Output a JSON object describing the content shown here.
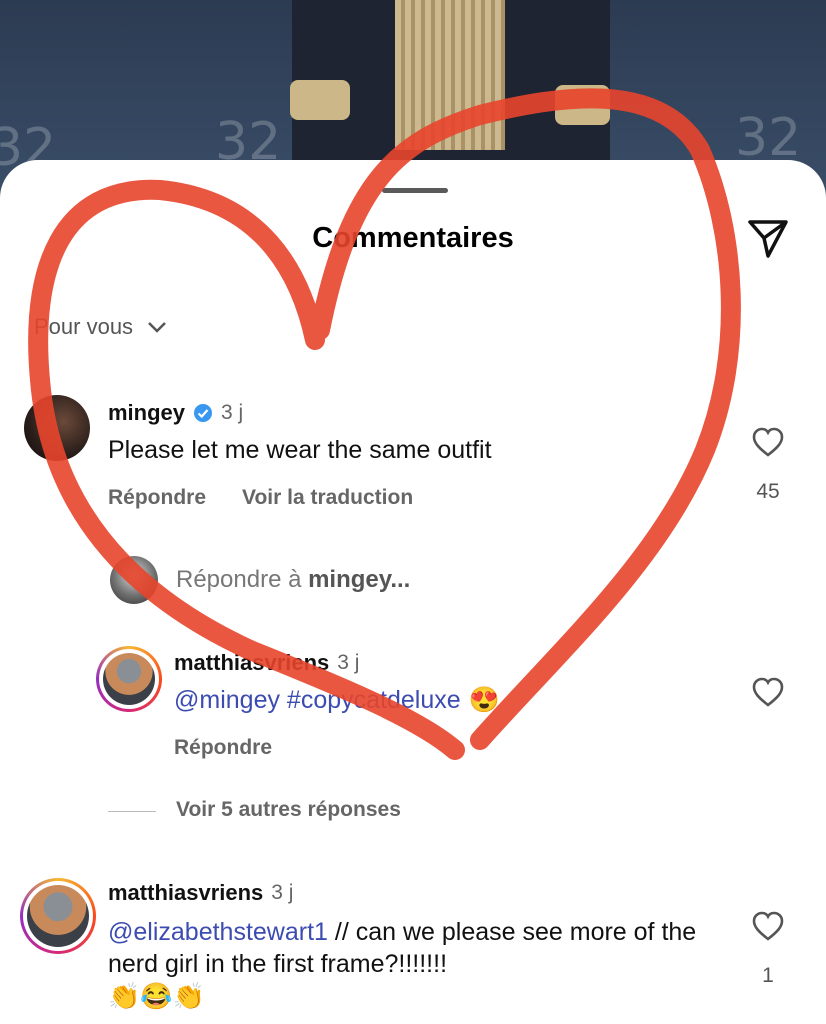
{
  "header": {
    "title": "Commentaires",
    "sort_label": "Pour vous",
    "send_icon": "paper-plane-icon"
  },
  "comments": [
    {
      "username": "mingey",
      "verified": true,
      "time": "3 j",
      "text": "Please let me wear the same outfit",
      "reply_label": "Répondre",
      "translate_label": "Voir la traduction",
      "likes": "45"
    },
    {
      "username": "matthiasvriens",
      "time": "3 j",
      "mention": "@elizabethstewart1",
      "text": " // can we please see more of the nerd girl in the first frame?!!!!!!!",
      "emojis": "👏😂👏",
      "likes": "1"
    }
  ],
  "reply_input": {
    "placeholder_prefix": "Répondre à ",
    "placeholder_user": "mingey..."
  },
  "reply": {
    "username": "matthiasvriens",
    "time": "3 j",
    "text": "@mingey #copycatdeluxe",
    "emoji": "😍",
    "reply_label": "Répondre"
  },
  "more_replies_label": "Voir 5 autres réponses",
  "colors": {
    "link": "#3c4cb1",
    "heart_overlay": "#e8452c",
    "verified": "#3897f0"
  }
}
